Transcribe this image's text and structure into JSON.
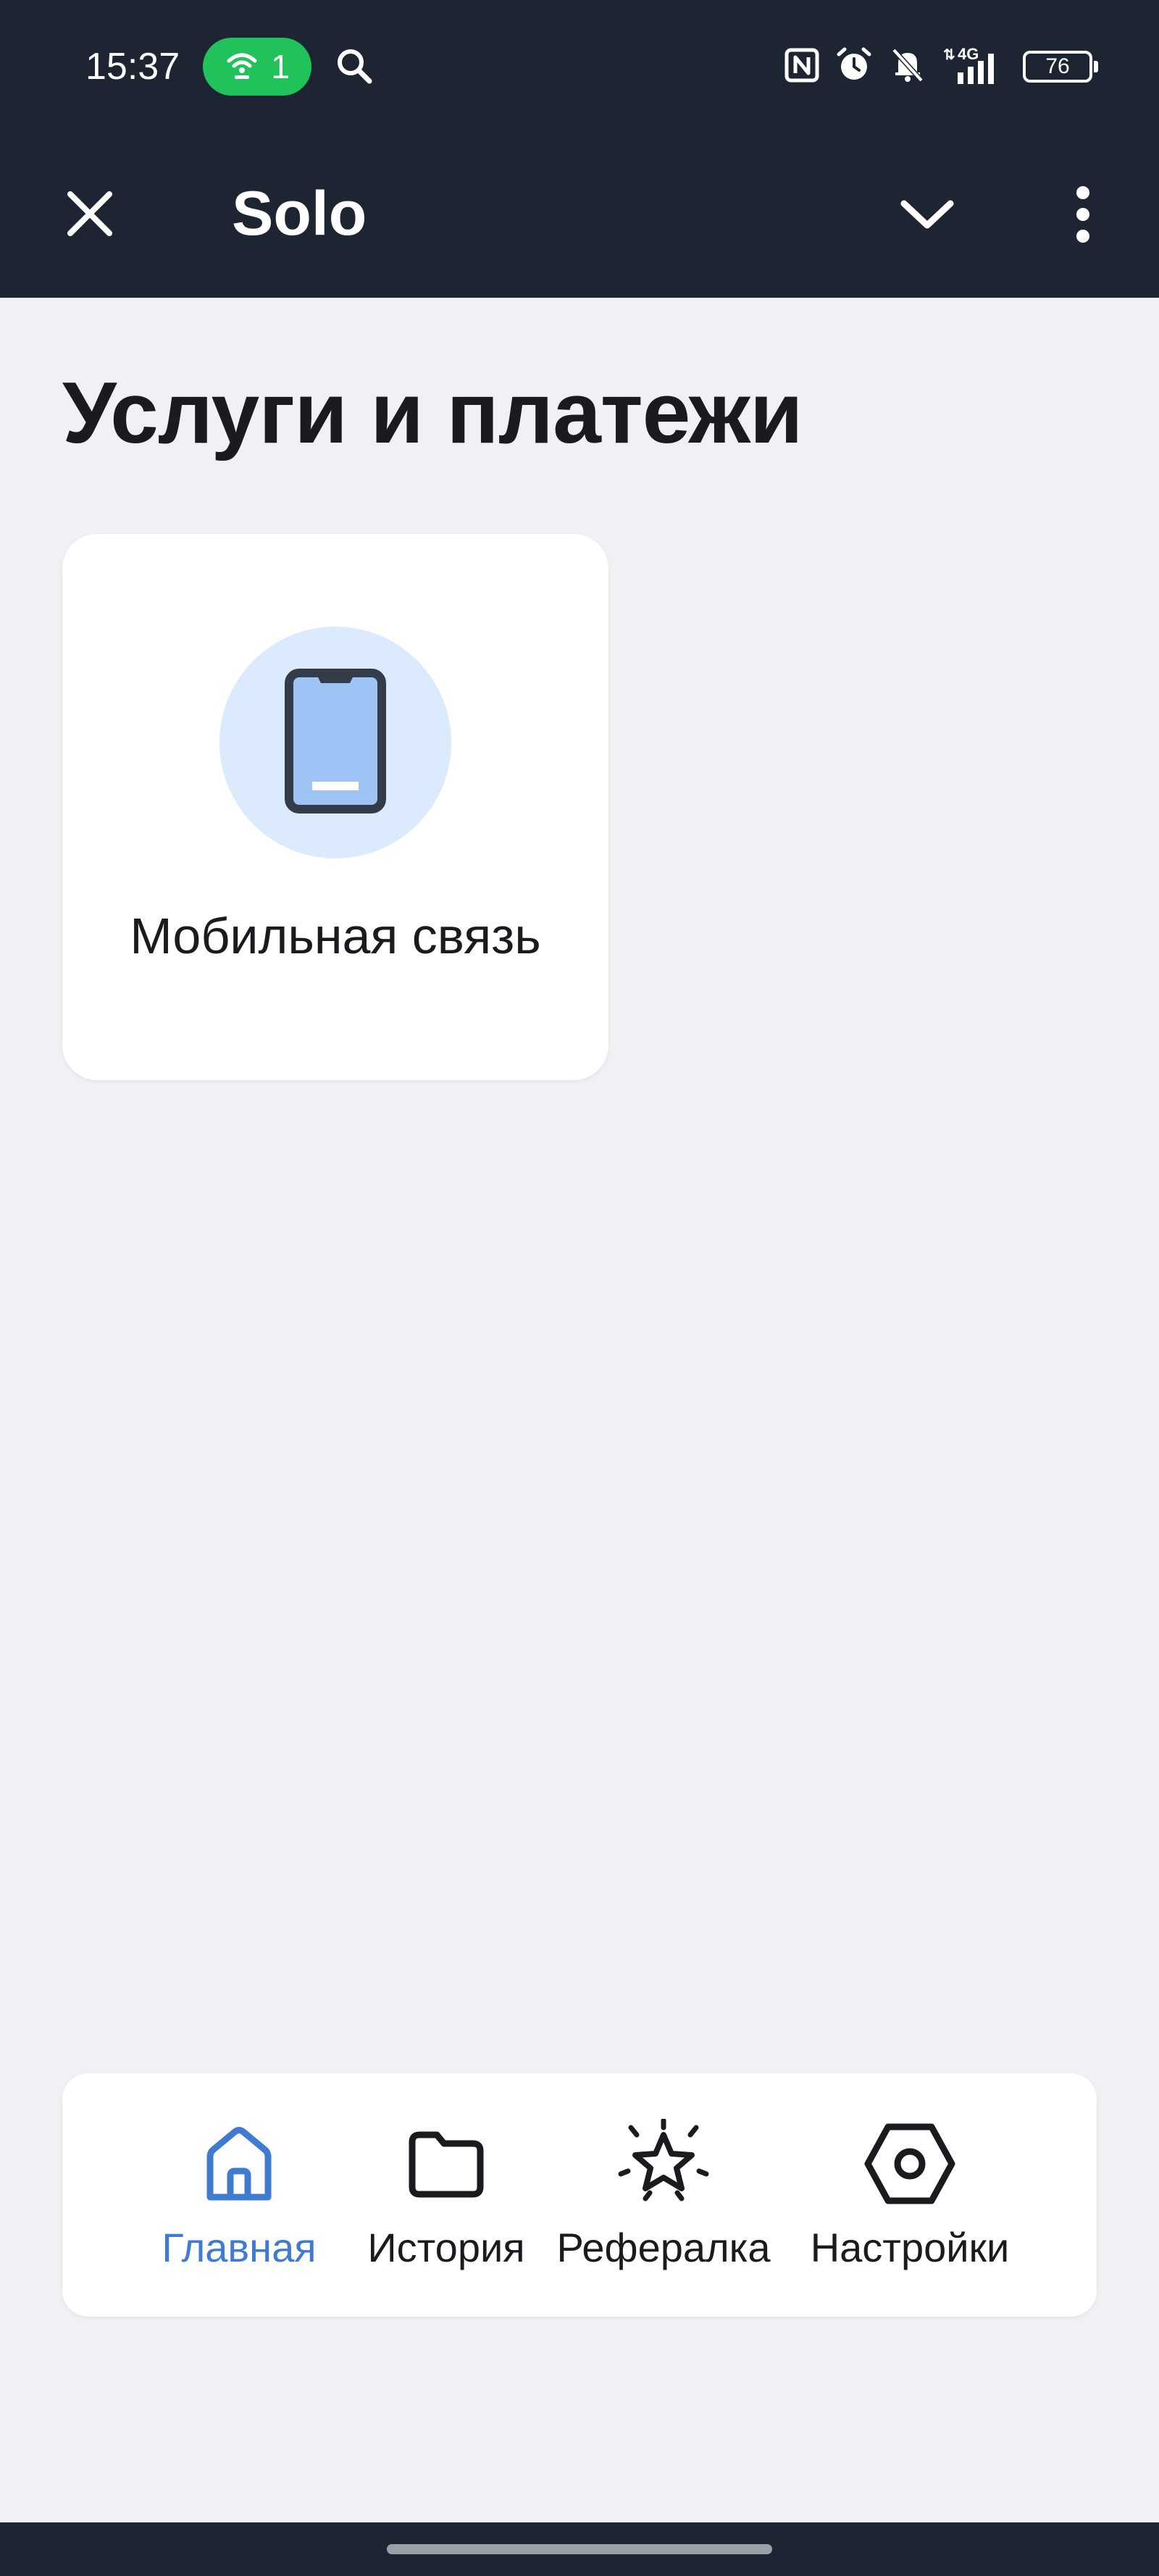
{
  "status_bar": {
    "time": "15:37",
    "hotspot_count": "1",
    "network": "4G",
    "battery_level": "76"
  },
  "app_bar": {
    "title": "Solo",
    "icons": [
      "close-icon",
      "chevron-down-icon",
      "more-vertical-icon"
    ]
  },
  "page": {
    "title": "Услуги и платежи"
  },
  "services": [
    {
      "label": "Мобильная связь",
      "icon": "mobile-phone-icon"
    }
  ],
  "bottom_nav": {
    "items": [
      {
        "label": "Главная",
        "icon": "home-icon",
        "active": true
      },
      {
        "label": "История",
        "icon": "folder-icon",
        "active": false
      },
      {
        "label": "Рефералка",
        "icon": "sparkle-star-icon",
        "active": false
      },
      {
        "label": "Настройки",
        "icon": "settings-hex-icon",
        "active": false
      }
    ]
  },
  "colors": {
    "header_bg": "#1d2532",
    "page_bg": "#f1f1f5",
    "accent": "#3f7bd0",
    "hotspot_green": "#21c25a",
    "icon_circle": "#dbeafc"
  }
}
